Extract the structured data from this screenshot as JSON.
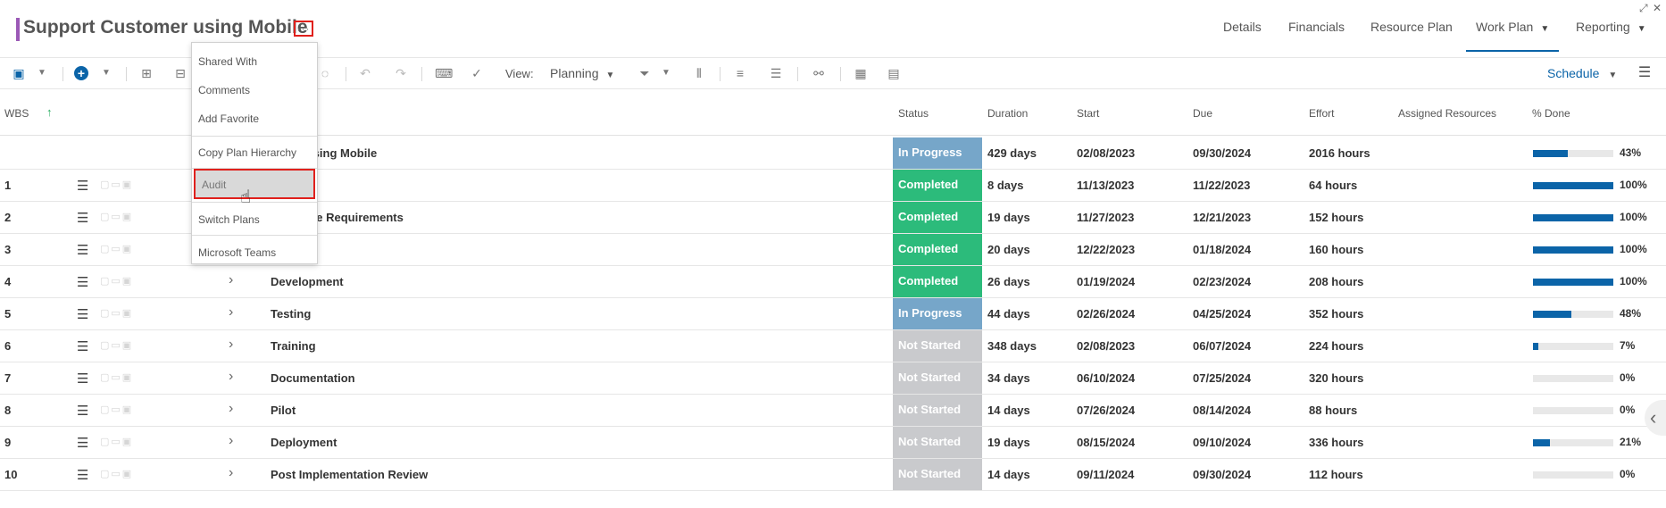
{
  "header": {
    "title": "Support Customer using Mobile",
    "more_label": "···",
    "tabs": [
      {
        "label": "Details"
      },
      {
        "label": "Financials"
      },
      {
        "label": "Resource Plan"
      },
      {
        "label": "Work Plan"
      },
      {
        "label": "Reporting"
      }
    ]
  },
  "toolbar": {
    "view_label": "View:",
    "view_value": "Planning",
    "schedule_label": "Schedule"
  },
  "menu": {
    "items": [
      {
        "label": "Shared With"
      },
      {
        "label": "Comments"
      },
      {
        "label": "Add Favorite"
      },
      {
        "label": "Copy Plan Hierarchy"
      },
      {
        "label": "Audit"
      },
      {
        "label": "Switch Plans"
      },
      {
        "label": "Microsoft Teams"
      }
    ]
  },
  "columns": {
    "wbs": "WBS",
    "status": "Status",
    "duration": "Duration",
    "start": "Start",
    "due": "Due",
    "effort": "Effort",
    "assigned": "Assigned Resources",
    "done": "% Done"
  },
  "colors": {
    "in_progress": "#76a6c9",
    "completed": "#2cbb7b",
    "not_started": "#c9cacd",
    "accent": "#0b64a8",
    "highlight": "#e0201c"
  },
  "rows": [
    {
      "wbs": "",
      "name": "tomer using Mobile",
      "status": "In Progress",
      "duration": "429 days",
      "start": "02/08/2023",
      "due": "09/30/2024",
      "effort": "2016 hours",
      "done": 43,
      "done_label": "43%"
    },
    {
      "wbs": "1",
      "name": "",
      "status": "Completed",
      "duration": "8 days",
      "start": "11/13/2023",
      "due": "11/22/2023",
      "effort": "64 hours",
      "done": 100,
      "done_label": "100%"
    },
    {
      "wbs": "2",
      "name": "/Software Requirements",
      "status": "Completed",
      "duration": "19 days",
      "start": "11/27/2023",
      "due": "12/21/2023",
      "effort": "152 hours",
      "done": 100,
      "done_label": "100%"
    },
    {
      "wbs": "3",
      "name": "",
      "status": "Completed",
      "duration": "20 days",
      "start": "12/22/2023",
      "due": "01/18/2024",
      "effort": "160 hours",
      "done": 100,
      "done_label": "100%"
    },
    {
      "wbs": "4",
      "name": "Development",
      "status": "Completed",
      "duration": "26 days",
      "start": "01/19/2024",
      "due": "02/23/2024",
      "effort": "208 hours",
      "done": 100,
      "done_label": "100%"
    },
    {
      "wbs": "5",
      "name": "Testing",
      "status": "In Progress",
      "duration": "44 days",
      "start": "02/26/2024",
      "due": "04/25/2024",
      "effort": "352 hours",
      "done": 48,
      "done_label": "48%"
    },
    {
      "wbs": "6",
      "name": "Training",
      "status": "Not Started",
      "duration": "348 days",
      "start": "02/08/2023",
      "due": "06/07/2024",
      "effort": "224 hours",
      "done": 7,
      "done_label": "7%"
    },
    {
      "wbs": "7",
      "name": "Documentation",
      "status": "Not Started",
      "duration": "34 days",
      "start": "06/10/2024",
      "due": "07/25/2024",
      "effort": "320 hours",
      "done": 0,
      "done_label": "0%"
    },
    {
      "wbs": "8",
      "name": "Pilot",
      "status": "Not Started",
      "duration": "14 days",
      "start": "07/26/2024",
      "due": "08/14/2024",
      "effort": "88 hours",
      "done": 0,
      "done_label": "0%"
    },
    {
      "wbs": "9",
      "name": "Deployment",
      "status": "Not Started",
      "duration": "19 days",
      "start": "08/15/2024",
      "due": "09/10/2024",
      "effort": "336 hours",
      "done": 21,
      "done_label": "21%"
    },
    {
      "wbs": "10",
      "name": "Post Implementation Review",
      "status": "Not Started",
      "duration": "14 days",
      "start": "09/11/2024",
      "due": "09/30/2024",
      "effort": "112 hours",
      "done": 0,
      "done_label": "0%"
    }
  ]
}
